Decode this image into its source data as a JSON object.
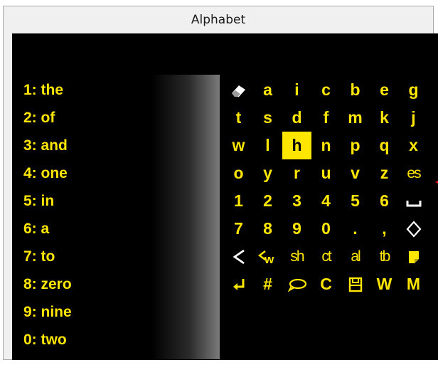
{
  "window": {
    "title": "Alphabet"
  },
  "predictions": [
    {
      "label": "1: the"
    },
    {
      "label": "2: of"
    },
    {
      "label": "3: and"
    },
    {
      "label": "4: one"
    },
    {
      "label": "5: in"
    },
    {
      "label": "6: a"
    },
    {
      "label": "7: to"
    },
    {
      "label": "8: zero"
    },
    {
      "label": "9: nine"
    },
    {
      "label": "0: two"
    }
  ],
  "keys": {
    "r0": {
      "c1": "a",
      "c2": "i",
      "c3": "c",
      "c4": "b",
      "c5": "e",
      "c6": "g"
    },
    "r1": {
      "c0": "t",
      "c1": "s",
      "c2": "d",
      "c3": "f",
      "c4": "m",
      "c5": "k",
      "c6": "j"
    },
    "r2": {
      "c0": "w",
      "c1": "l",
      "c2": "h",
      "c3": "n",
      "c4": "p",
      "c5": "q",
      "c6": "x"
    },
    "r3": {
      "c0": "o",
      "c1": "y",
      "c2": "r",
      "c3": "u",
      "c4": "v",
      "c5": "z",
      "c6": "es"
    },
    "r4": {
      "c0": "1",
      "c1": "2",
      "c2": "3",
      "c3": "4",
      "c4": "5",
      "c5": "6"
    },
    "r5": {
      "c0": "7",
      "c1": "8",
      "c2": "9",
      "c3": "0",
      "c4": ".",
      "c5": ","
    },
    "r6": {
      "c2": "sh",
      "c3": "ct",
      "c4": "al",
      "c5": "tb"
    },
    "r7": {
      "c1": "#",
      "c3": "C",
      "c5": "W",
      "c6": "M"
    }
  },
  "selected_key": "h",
  "icons": {
    "eraser": "eraser-icon",
    "space": "space-icon",
    "diamond": "diamond-icon",
    "back": "back-arrow-icon",
    "back_word": "back-word-icon",
    "note": "note-icon",
    "enter": "enter-icon",
    "speech": "speech-bubble-icon",
    "save": "save-icon"
  },
  "colors": {
    "text": "#ffe600",
    "background": "#000000",
    "selection": "#ffe600"
  }
}
